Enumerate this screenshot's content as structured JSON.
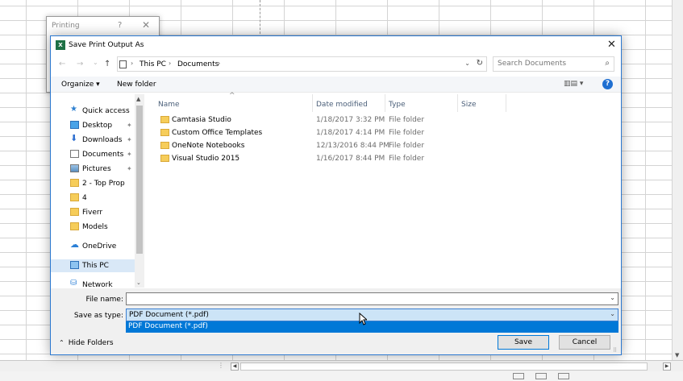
{
  "printing_dialog": {
    "title": "Printing",
    "help": "?",
    "close": "✕"
  },
  "dialog": {
    "app_icon_text": "X",
    "title": "Save Print Output As",
    "close": "✕"
  },
  "address": {
    "back": "←",
    "forward": "→",
    "recent": "⌄",
    "up": "↑",
    "crumbs": [
      "This PC",
      "Documents"
    ],
    "separator": "›",
    "dropdown": "⌄",
    "refresh": "↻"
  },
  "search": {
    "placeholder": "Search Documents",
    "icon": "⌕"
  },
  "toolbar": {
    "organize": "Organize ▾",
    "new_folder": "New folder",
    "views": "▥▤ ▾",
    "help": "?"
  },
  "nav": {
    "items": [
      {
        "label": "Quick access",
        "icon": "star-icon",
        "pinned": false
      },
      {
        "label": "Desktop",
        "icon": "desktop-icon",
        "pinned": true
      },
      {
        "label": "Downloads",
        "icon": "download-icon",
        "pinned": true
      },
      {
        "label": "Documents",
        "icon": "document-icon",
        "pinned": true
      },
      {
        "label": "Pictures",
        "icon": "pictures-icon",
        "pinned": true
      },
      {
        "label": "2 - Top Prop",
        "icon": "folder-icon",
        "pinned": false
      },
      {
        "label": "4",
        "icon": "folder-icon",
        "pinned": false
      },
      {
        "label": "Fiverr",
        "icon": "folder-icon",
        "pinned": false
      },
      {
        "label": "Models",
        "icon": "folder-icon",
        "pinned": false
      },
      {
        "label": "OneDrive",
        "icon": "onedrive-icon",
        "pinned": false
      },
      {
        "label": "This PC",
        "icon": "pc-icon",
        "pinned": false,
        "selected": true
      },
      {
        "label": "Network",
        "icon": "network-icon",
        "pinned": false
      }
    ],
    "pin_glyph": "📌"
  },
  "filelist": {
    "columns": [
      "Name",
      "Date modified",
      "Type",
      "Size"
    ],
    "sort_glyph": "^",
    "rows": [
      {
        "name": "Camtasia Studio",
        "date": "1/18/2017 3:32 PM",
        "type": "File folder"
      },
      {
        "name": "Custom Office Templates",
        "date": "1/18/2017 4:14 PM",
        "type": "File folder"
      },
      {
        "name": "OneNote Notebooks",
        "date": "12/13/2016 8:44 PM",
        "type": "File folder"
      },
      {
        "name": "Visual Studio 2015",
        "date": "1/16/2017 8:44 PM",
        "type": "File folder"
      }
    ]
  },
  "form": {
    "file_name_label": "File name:",
    "file_name_value": "",
    "save_type_label": "Save as type:",
    "save_type_value": "PDF Document (*.pdf)",
    "save_type_options": [
      "PDF Document (*.pdf)"
    ],
    "dropdown": "⌄"
  },
  "footer": {
    "hide_folders": "Hide Folders",
    "save": "Save",
    "cancel": "Cancel"
  },
  "colors": {
    "accent": "#0078d7",
    "selection": "#cce4f7",
    "folder": "#f6cd5a",
    "excel": "#1e7145"
  }
}
